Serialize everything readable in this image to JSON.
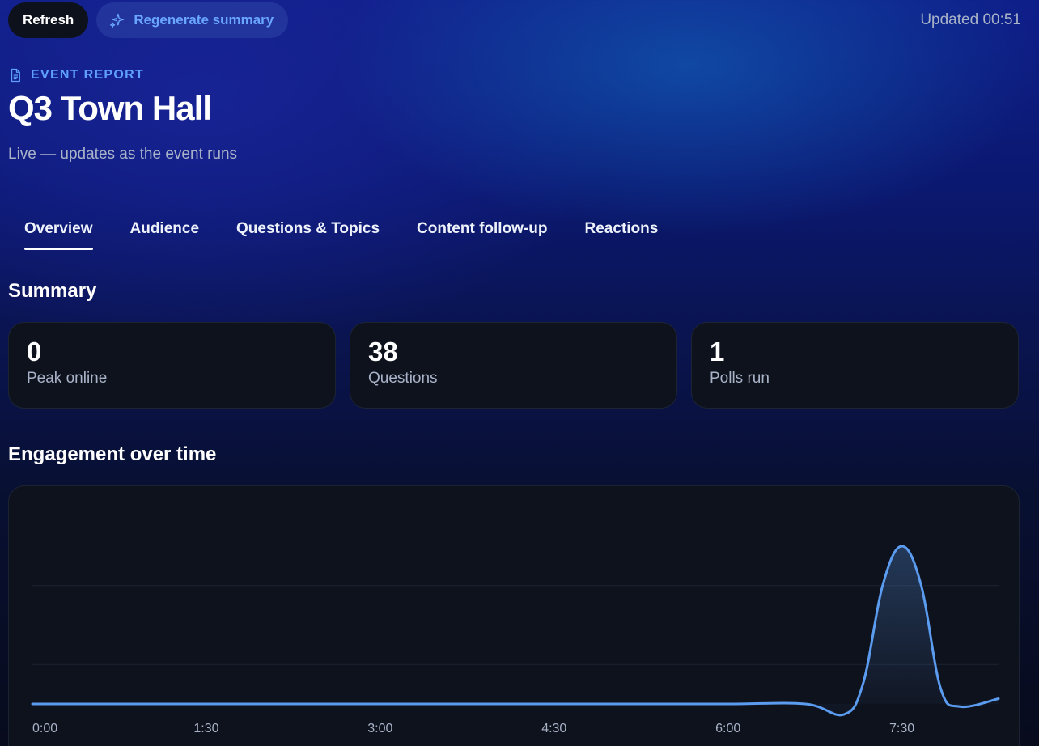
{
  "toolbar": {
    "refresh_label": "Refresh",
    "regenerate_label": "Regenerate summary",
    "regenerate_icon": "sparkle-icon",
    "updated_text": "Updated 00:51"
  },
  "header": {
    "kicker": "EVENT REPORT",
    "kicker_icon": "document-icon",
    "title": "Q3 Town Hall",
    "subtitle": "Live — updates as the event runs"
  },
  "tabs": [
    {
      "label": "Overview",
      "active": true
    },
    {
      "label": "Audience",
      "active": false
    },
    {
      "label": "Questions & Topics",
      "active": false
    },
    {
      "label": "Content follow-up",
      "active": false
    },
    {
      "label": "Reactions",
      "active": false
    }
  ],
  "summary": {
    "heading": "Summary",
    "cards": [
      {
        "value": "0",
        "label": "Peak online"
      },
      {
        "value": "38",
        "label": "Questions"
      },
      {
        "value": "1",
        "label": "Polls run"
      }
    ]
  },
  "engagement": {
    "heading": "Engagement over time"
  },
  "colors": {
    "accent": "#5fa0ff",
    "line": "#5b9cf0",
    "card_bg": "#0e121d",
    "muted_text": "#a9b3c8"
  },
  "chart_data": {
    "type": "line",
    "x_tick_labels": [
      "0:00",
      "1:30",
      "3:00",
      "4:30",
      "6:00",
      "7:30"
    ],
    "x_unit": "minutes",
    "x": [
      0,
      60,
      120,
      180,
      240,
      300,
      360,
      400,
      420,
      430,
      440,
      450,
      460,
      470,
      480,
      500
    ],
    "y": [
      0,
      0,
      0,
      0,
      0,
      0,
      0,
      0,
      -0.4,
      0.8,
      4.5,
      6.0,
      4.5,
      0.6,
      -0.1,
      0.2
    ],
    "ylim": [
      -0.8,
      6.8
    ],
    "grid": true,
    "title": "",
    "xlabel": "",
    "ylabel": ""
  }
}
